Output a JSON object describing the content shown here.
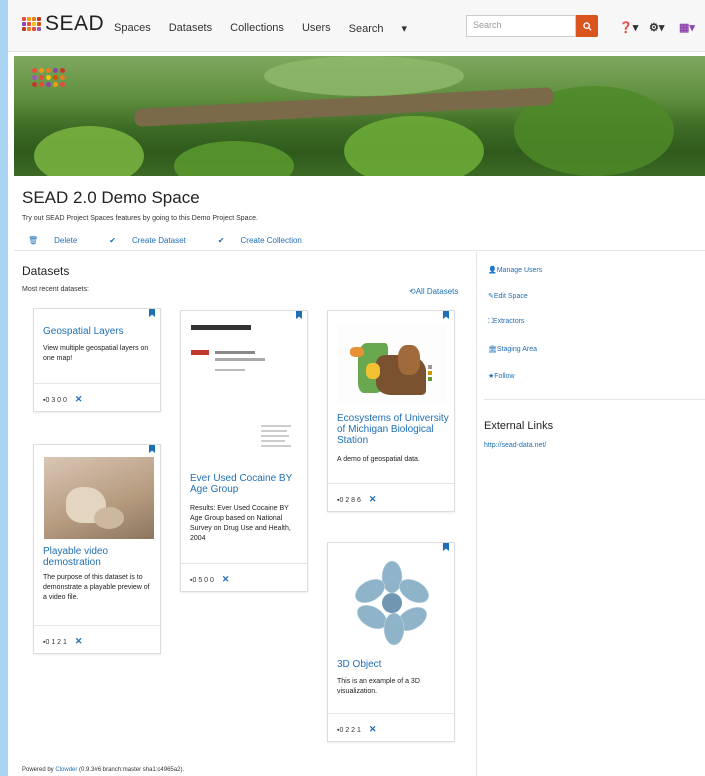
{
  "navbar": {
    "brand": "SEAD",
    "links": [
      "Spaces",
      "Datasets",
      "Collections",
      "Users",
      "Search"
    ],
    "search_placeholder": "Search",
    "icons": [
      "search-icon",
      "help-icon",
      "gear-icon",
      "user-avatar-icon"
    ]
  },
  "space": {
    "title": "SEAD 2.0 Demo Space",
    "subtitle": "Try out SEAD Project Spaces features by going to this Demo Project Space.",
    "actions": [
      "Delete",
      "Create Dataset",
      "Create Collection"
    ]
  },
  "datasets": {
    "heading": "Datasets",
    "recent_label": "Most recent datasets:",
    "all_label": "All Datasets",
    "cards": [
      {
        "title": "Geospatial Layers",
        "desc": "View multiple geospatial layers on one map!",
        "stats": "0 3 0 0"
      },
      {
        "title": "Ever Used Cocaine BY Age Group",
        "desc": "Results: Ever Used Cocaine BY Age Group based on National Survey on Drug Use and Health, 2004",
        "stats": "0 5 0 0"
      },
      {
        "title": "Ecosystems of University of Michigan Biological Station",
        "desc": "A demo of geospatial data.",
        "stats": "0 2 8 6"
      },
      {
        "title": "Playable video demostration",
        "desc": "The purpose of this dataset is to demonstrate a playable preview of a video file.",
        "stats": "0 1 2 1"
      },
      {
        "title": "3D Object",
        "desc": "This is an example of a 3D visualization.",
        "stats": "0 2 2 1"
      }
    ]
  },
  "sidebar": {
    "links": [
      "Manage Users",
      "Edit Space",
      "Extractors",
      "Staging Area",
      "Follow"
    ],
    "external_heading": "External Links",
    "external_url": "http://sead-data.net/"
  },
  "footer": {
    "prefix": "Powered by",
    "link": "Clowder",
    "version": "(0.9.3#6 branch:master sha1:c4965a2)."
  },
  "colors": {
    "accent": "#1f6fb5",
    "search_button": "#d9541e",
    "background": "#a9d4f2"
  }
}
